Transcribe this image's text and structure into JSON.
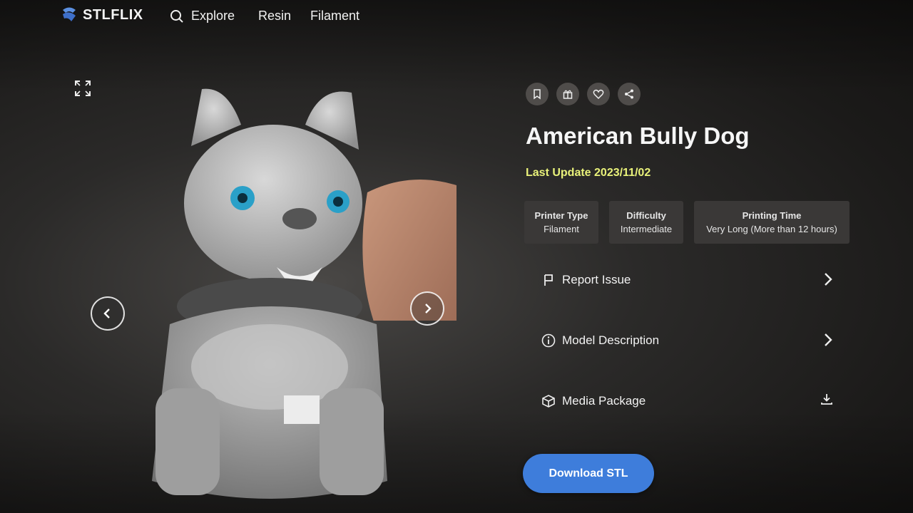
{
  "brand": {
    "name": "STLFLIX"
  },
  "nav": {
    "explore": "Explore",
    "resin": "Resin",
    "filament": "Filament"
  },
  "model": {
    "title": "American Bully Dog",
    "last_update": "Last Update 2023/11/02"
  },
  "specs": [
    {
      "label": "Printer Type",
      "value": "Filament"
    },
    {
      "label": "Difficulty",
      "value": "Intermediate"
    },
    {
      "label": "Printing Time",
      "value": "Very Long (More than 12 hours)"
    }
  ],
  "rows": {
    "report": "Report Issue",
    "description": "Model Description",
    "media": "Media Package"
  },
  "download": {
    "label": "Download STL"
  },
  "colors": {
    "accent": "#3e7ddb",
    "update": "#e9f27a",
    "panel": "#3a3837"
  },
  "icons": [
    "search-icon",
    "expand-icon",
    "chevron-left-icon",
    "chevron-right-icon",
    "bookmark-icon",
    "gift-icon",
    "heart-icon",
    "share-icon",
    "flag-icon",
    "info-icon",
    "cube-icon",
    "download-icon"
  ]
}
